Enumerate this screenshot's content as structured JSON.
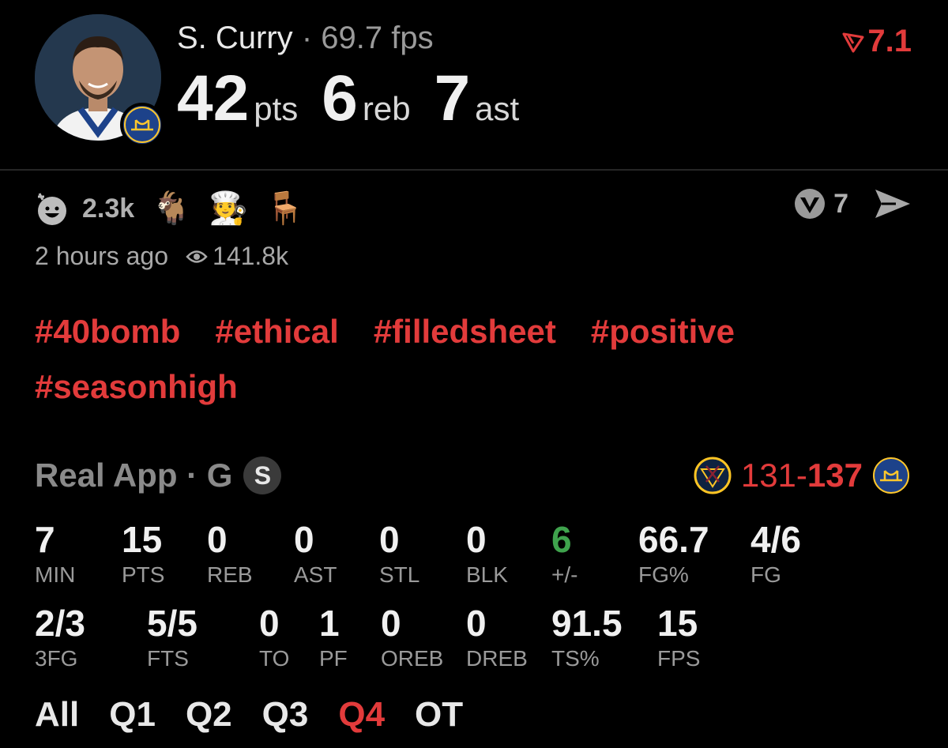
{
  "header": {
    "player_name": "S. Curry",
    "separator": "·",
    "fantasy_score": "69.7 fps",
    "points": "42",
    "points_unit": "pts",
    "rebounds": "6",
    "rebounds_unit": "reb",
    "assists": "7",
    "assists_unit": "ast",
    "rating_value": "7.1"
  },
  "reactions": {
    "count": "2.3k",
    "items": [
      "goat-emoji",
      "chef-emoji",
      "chair-emoji"
    ],
    "vote_count": "7"
  },
  "meta": {
    "time_ago": "2 hours ago",
    "views": "141.8k"
  },
  "tags": [
    "#40bomb",
    "#ethical",
    "#filledsheet",
    "#positive",
    "#seasonhigh"
  ],
  "game": {
    "label": "Real App · G",
    "badge": "S",
    "away_score": "131",
    "dash": "-",
    "home_score": "137"
  },
  "stats_row1": [
    {
      "value": "7",
      "label": "MIN"
    },
    {
      "value": "15",
      "label": "PTS"
    },
    {
      "value": "0",
      "label": "REB"
    },
    {
      "value": "0",
      "label": "AST"
    },
    {
      "value": "0",
      "label": "STL"
    },
    {
      "value": "0",
      "label": "BLK"
    },
    {
      "value": "6",
      "label": "+/-"
    },
    {
      "value": "66.7",
      "label": "FG%"
    },
    {
      "value": "4/6",
      "label": "FG"
    }
  ],
  "stats_row2": [
    {
      "value": "2/3",
      "label": "3FG"
    },
    {
      "value": "5/5",
      "label": "FTS"
    },
    {
      "value": "0",
      "label": "TO"
    },
    {
      "value": "1",
      "label": "PF"
    },
    {
      "value": "0",
      "label": "OREB"
    },
    {
      "value": "0",
      "label": "DREB"
    },
    {
      "value": "91.5",
      "label": "TS%"
    },
    {
      "value": "15",
      "label": "FPS"
    }
  ],
  "quarters": [
    "All",
    "Q1",
    "Q2",
    "Q3",
    "Q4",
    "OT"
  ],
  "active_quarter": "Q4",
  "colors": {
    "accent": "#e23b3b",
    "positive": "#3fa34d",
    "background": "#000000"
  }
}
